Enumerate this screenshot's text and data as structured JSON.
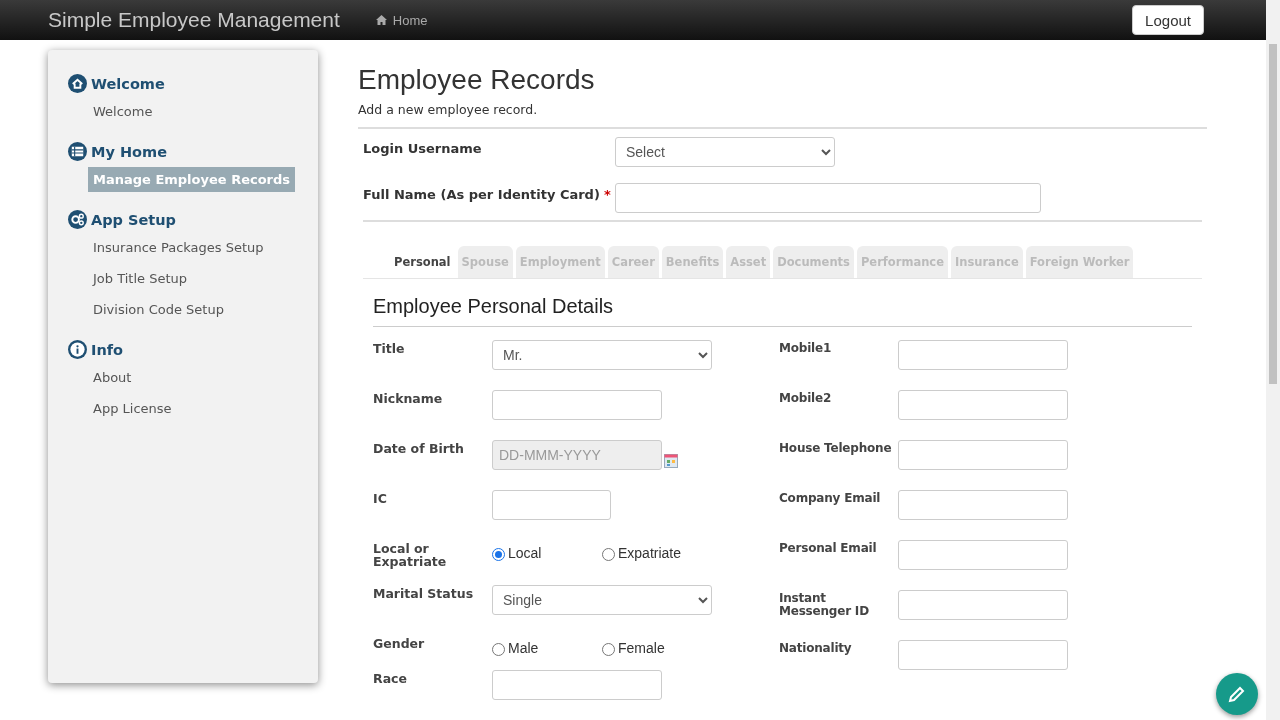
{
  "navbar": {
    "brand": "Simple Employee Management",
    "links": [
      {
        "label": "Home"
      }
    ],
    "logout": "Logout"
  },
  "sidebar": {
    "sections": [
      {
        "title": "Welcome",
        "items": [
          {
            "label": "Welcome",
            "selected": false
          }
        ]
      },
      {
        "title": "My Home",
        "items": [
          {
            "label": "Manage Employee Records",
            "selected": true
          }
        ]
      },
      {
        "title": "App Setup",
        "items": [
          {
            "label": "Insurance Packages Setup",
            "selected": false
          },
          {
            "label": "Job Title Setup",
            "selected": false
          },
          {
            "label": "Division Code Setup",
            "selected": false
          }
        ]
      },
      {
        "title": "Info",
        "items": [
          {
            "label": "About",
            "selected": false
          },
          {
            "label": "App License",
            "selected": false
          }
        ]
      }
    ]
  },
  "page": {
    "title": "Employee Records",
    "subtitle": "Add a new employee record."
  },
  "top_fields": [
    {
      "label": "Login Username",
      "kind": "select",
      "value": "Select"
    },
    {
      "label": "Full Name (As per Identity Card)",
      "kind": "wide_text",
      "required_mark": "*"
    }
  ],
  "tabs": [
    {
      "label": "Personal",
      "selected": true
    },
    {
      "label": "Spouse",
      "selected": false
    },
    {
      "label": "Employment",
      "selected": false
    },
    {
      "label": "Career",
      "selected": false
    },
    {
      "label": "Benefits",
      "selected": false
    },
    {
      "label": "Asset",
      "selected": false
    },
    {
      "label": "Documents",
      "selected": false
    },
    {
      "label": "Performance",
      "selected": false
    },
    {
      "label": "Insurance",
      "selected": false
    },
    {
      "label": "Foreign Worker",
      "selected": false
    }
  ],
  "section_title": "Employee Personal Details",
  "fields_left": [
    {
      "label": "Title",
      "kind": "select",
      "value": "Mr."
    },
    {
      "label": "Nickname",
      "kind": "text"
    },
    {
      "label": "Date of Birth",
      "kind": "date",
      "placeholder": "DD-MMM-YYYY"
    },
    {
      "label": "IC",
      "kind": "short_text"
    },
    {
      "label": "Local or Expatriate",
      "kind": "radio",
      "options": [
        {
          "label": "Local",
          "selected": true
        },
        {
          "label": "Expatriate",
          "selected": false
        }
      ]
    },
    {
      "label": "Marital Status",
      "kind": "select",
      "value": "Single"
    },
    {
      "label": "Gender",
      "kind": "radio",
      "options": [
        {
          "label": "Male",
          "selected": false
        },
        {
          "label": "Female",
          "selected": false
        }
      ]
    },
    {
      "label": "Race",
      "kind": "text"
    }
  ],
  "fields_right": [
    {
      "label": "Mobile1",
      "kind": "text"
    },
    {
      "label": "Mobile2",
      "kind": "text"
    },
    {
      "label": "House Telephone",
      "kind": "text"
    },
    {
      "label": "Company Email",
      "kind": "text"
    },
    {
      "label": "Personal Email",
      "kind": "text"
    },
    {
      "label": "Instant Messenger ID",
      "kind": "text"
    },
    {
      "label": "Nationality",
      "kind": "text"
    }
  ]
}
